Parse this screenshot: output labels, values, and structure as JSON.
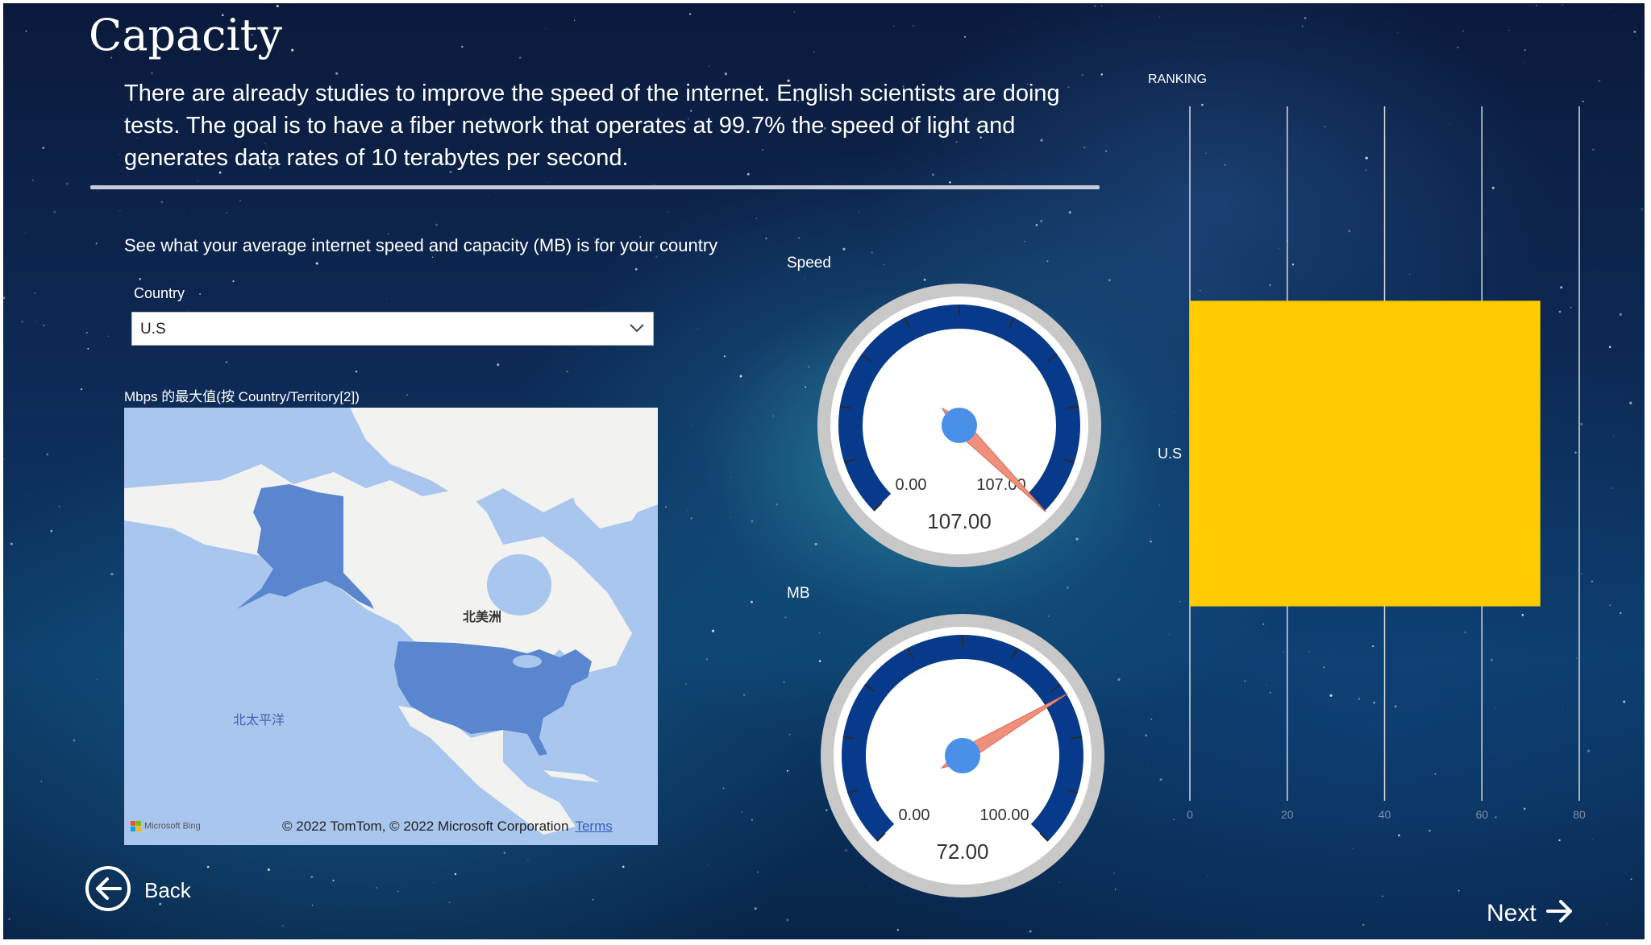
{
  "page": {
    "title": "Capacity",
    "intro": "There are already studies to improve the speed of the internet. English scientists are doing tests. The goal is to have a fiber network that operates at 99.7% the speed of light and generates data rates of 10 terabytes per second.",
    "subtitle": "See what your average internet speed and capacity (MB) is for your country"
  },
  "filter": {
    "label": "Country",
    "value": "U.S"
  },
  "map": {
    "title": "Mbps 的最大值(按 Country/Territory[2])",
    "label_continent": "北美洲",
    "label_ocean": "北太平洋",
    "attribution": "© 2022 TomTom, © 2022 Microsoft Corporation",
    "terms_label": "Terms",
    "bing_label": "Microsoft Bing"
  },
  "speed_gauge": {
    "label": "Speed",
    "min": 0,
    "max": 107,
    "value": 107,
    "min_text": "0.00",
    "max_text": "107.00",
    "value_text": "107.00"
  },
  "mb_gauge": {
    "label": "MB",
    "min": 0,
    "max": 100,
    "value": 72,
    "min_text": "0.00",
    "max_text": "100.00",
    "value_text": "72.00"
  },
  "ranking": {
    "title": "RANKING",
    "chart_data": {
      "type": "bar",
      "orientation": "horizontal",
      "categories": [
        "U.S"
      ],
      "values": [
        72
      ],
      "xlim": [
        0,
        80
      ],
      "xticks": [
        0,
        20,
        40,
        60,
        80
      ],
      "bar_color": "#ffcc00",
      "grid": true
    }
  },
  "nav": {
    "back_label": "Back",
    "next_label": "Next"
  },
  "colors": {
    "gauge_band": "#073a8a",
    "gauge_rim": "#c8c8c8",
    "needle": "#f0907a",
    "hub": "#4a8fe8",
    "map_water": "#a9c6ee",
    "map_land": "#f2f2f0",
    "map_highlight": "#5a86cf"
  }
}
